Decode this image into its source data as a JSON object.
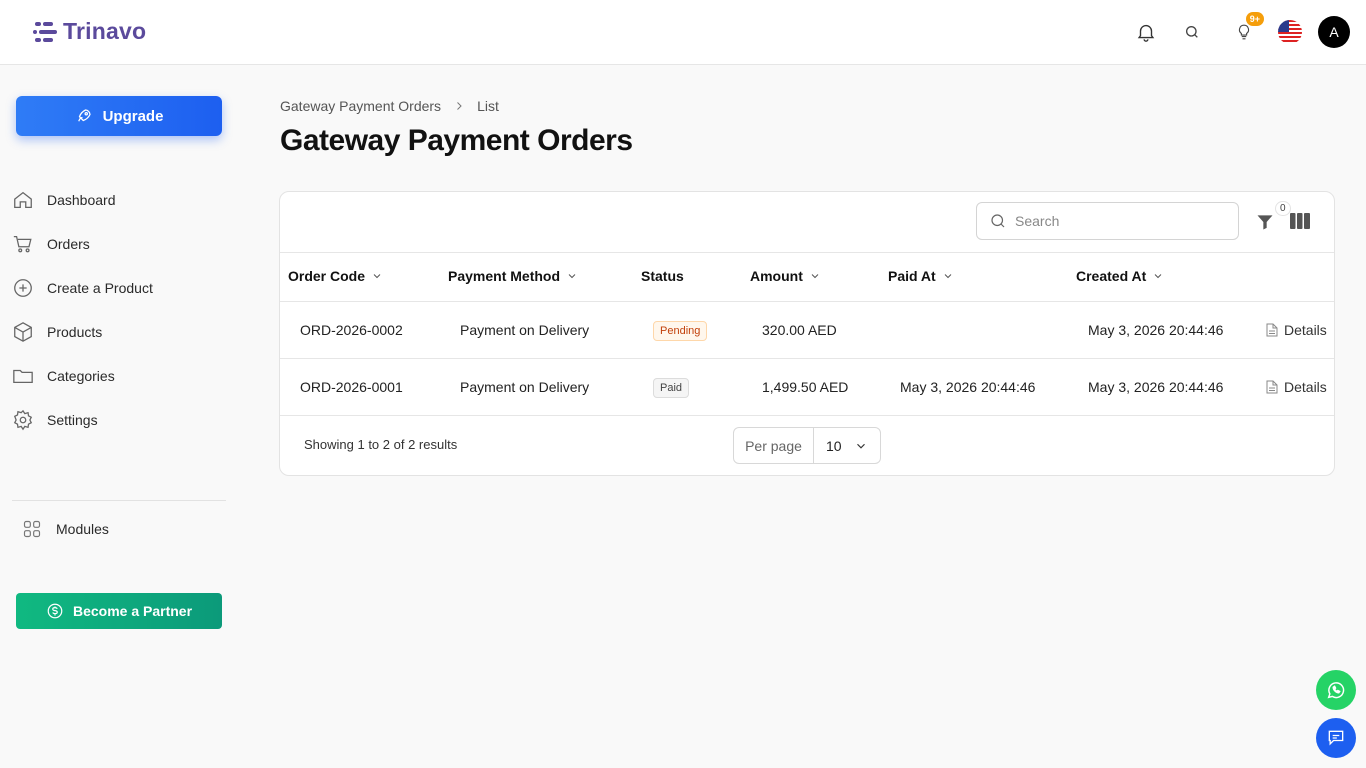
{
  "app": {
    "name": "Trinavo"
  },
  "header": {
    "notifications_badge": "9+",
    "avatar_initial": "A"
  },
  "sidebar": {
    "upgrade_label": "Upgrade",
    "items": [
      {
        "label": "Dashboard",
        "icon": "home-icon"
      },
      {
        "label": "Orders",
        "icon": "cart-icon"
      },
      {
        "label": "Create a Product",
        "icon": "plus-circle-icon"
      },
      {
        "label": "Products",
        "icon": "box-icon"
      },
      {
        "label": "Categories",
        "icon": "folder-icon"
      },
      {
        "label": "Settings",
        "icon": "gear-icon"
      }
    ],
    "modules_label": "Modules",
    "partner_label": "Become a Partner"
  },
  "breadcrumb": {
    "parent": "Gateway Payment Orders",
    "current": "List"
  },
  "page": {
    "title": "Gateway Payment Orders"
  },
  "table": {
    "search_placeholder": "Search",
    "filter_count": "0",
    "columns": [
      "Order Code",
      "Payment Method",
      "Status",
      "Amount",
      "Paid At",
      "Created At"
    ],
    "rows": [
      {
        "order_code": "ORD-2026-0002",
        "payment_method": "Payment on Delivery",
        "status": "Pending",
        "amount": "320.00 AED",
        "paid_at": "",
        "created_at": "May 3, 2026 20:44:46",
        "action": "Details"
      },
      {
        "order_code": "ORD-2026-0001",
        "payment_method": "Payment on Delivery",
        "status": "Paid",
        "amount": "1,499.50 AED",
        "paid_at": "May 3, 2026 20:44:46",
        "created_at": "May 3, 2026 20:44:46",
        "action": "Details"
      }
    ],
    "results_text": "Showing 1 to 2 of 2 results",
    "per_page_label": "Per page",
    "per_page_value": "10"
  },
  "colors": {
    "brand": "#5b4a9c",
    "primary": "#1d5ff0",
    "success": "#10b981",
    "pending": "#c2410c"
  }
}
